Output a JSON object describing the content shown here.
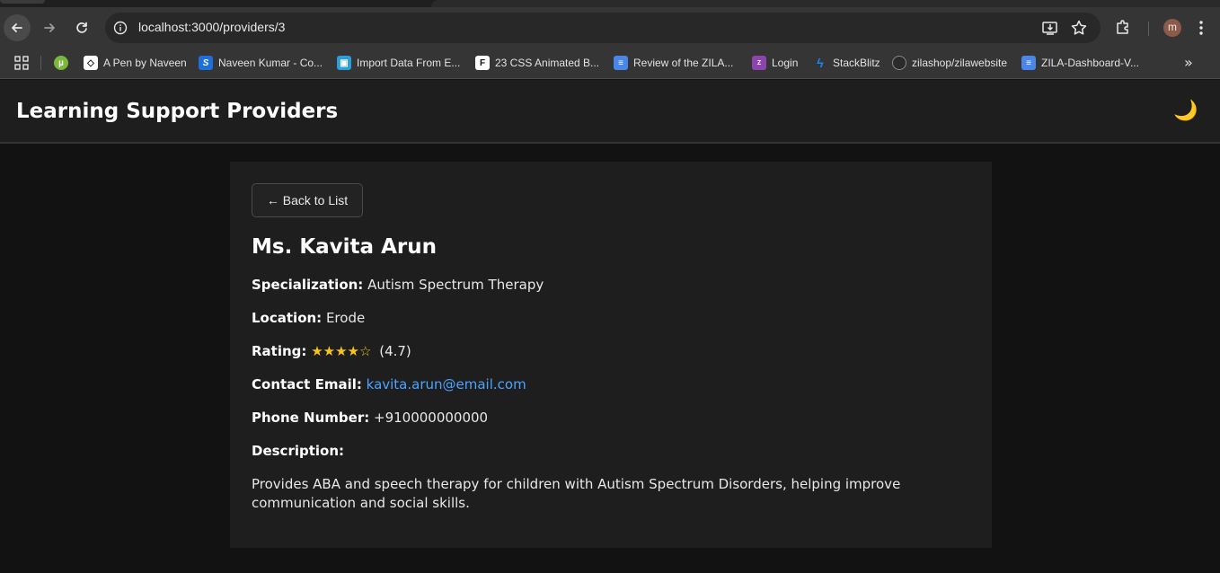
{
  "browser": {
    "url": "localhost:3000/providers/3",
    "profile_initial": "m",
    "bookmarks": [
      {
        "label": "",
        "icon": "utorrent-icon"
      },
      {
        "label": "A Pen by Naveen",
        "icon": "codepen-icon"
      },
      {
        "label": "Naveen Kumar - Co...",
        "icon": "s-icon"
      },
      {
        "label": "Import Data From E...",
        "icon": "import-icon"
      },
      {
        "label": "23 CSS Animated B...",
        "icon": "f-icon"
      },
      {
        "label": "Review of the ZILA...",
        "icon": "docs-icon"
      },
      {
        "label": "Login",
        "icon": "zila-icon"
      },
      {
        "label": "StackBlitz",
        "icon": "bolt-icon"
      },
      {
        "label": "zilashop/zilawebsite",
        "icon": "github-icon"
      },
      {
        "label": "ZILA-Dashboard-V...",
        "icon": "docs-icon"
      }
    ],
    "more_label": "»"
  },
  "header": {
    "title": "Learning Support Providers",
    "theme_icon": "🌙"
  },
  "provider": {
    "back_label": "← Back to List",
    "name": "Ms. Kavita Arun",
    "specialization_label": "Specialization:",
    "specialization": "Autism Spectrum Therapy",
    "location_label": "Location:",
    "location": "Erode",
    "rating_label": "Rating:",
    "rating_stars": "★★★★☆",
    "rating_value": "(4.7)",
    "rating": 4.7,
    "email_label": "Contact Email:",
    "email": "kavita.arun@email.com",
    "phone_label": "Phone Number:",
    "phone": "+910000000000",
    "description_label": "Description:",
    "description": "Provides ABA and speech therapy for children with Autism Spectrum Disorders, helping improve communication and social skills."
  },
  "colors": {
    "accent_link": "#4da3ff",
    "star": "#f5c518",
    "card_bg": "#1e1e1e",
    "page_bg": "#121212"
  }
}
